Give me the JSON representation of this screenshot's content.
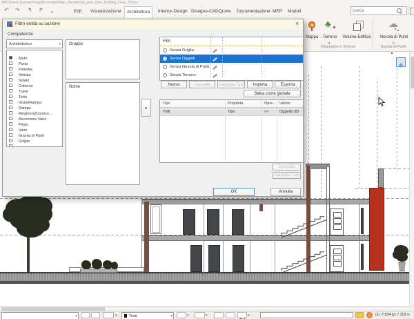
{
  "window": {
    "title": "ARCI5.test, Esempi-Progetti-completi\\Bari_Residential_park_First_Building_Final_TP.pso"
  },
  "ribbon": {
    "tabs": [
      "Edit",
      "Visualizzazione",
      "Architettura",
      "Interior-Design",
      "Disegno-CAD",
      "Quote",
      "Documentazione",
      "MEP",
      "Moduli"
    ],
    "active_tab": "Architettura",
    "search_placeholder": "Cerca",
    "groups": [
      {
        "label": "Volumetrie e Terreno",
        "buttons": [
          {
            "label": "Mappa"
          },
          {
            "label": "Terreno"
          },
          {
            "label": "Volume-Edificio"
          }
        ]
      },
      {
        "label": "Nuvola di Punti",
        "buttons": [
          {
            "label": "Nuvola di Punti"
          }
        ]
      }
    ]
  },
  "dialog": {
    "title": "Filtro entità su sezione",
    "section_label": "Competenze",
    "discipline": "Architettonico",
    "entities": [
      "Muro",
      "Porta",
      "Finestra",
      "Vetrata",
      "Solaio",
      "Colonna",
      "Trave",
      "Tetto",
      "Scala/Rampa",
      "Rampa",
      "Ringhiera/Cornice...",
      "Ascensore-Vano",
      "Plinto",
      "Vano",
      "Nuvola di Punti",
      "Griglia"
    ],
    "gruppo_label": "Gruppo",
    "nome_label": "Nome",
    "filters": {
      "header": "Filtri",
      "items": [
        {
          "label": "Senza Griglia",
          "selected": false
        },
        {
          "label": "Senza Oggetti",
          "selected": true
        },
        {
          "label": "Senza Nuvola di Punti",
          "selected": false
        },
        {
          "label": "Senza Terreno",
          "selected": false
        }
      ]
    },
    "buttons": {
      "nuovo": "Nuovo",
      "cancella": "Cancella",
      "cancella_tutti": "Cancella Tutti",
      "importa": "Importa",
      "esporta": "Esporta",
      "salva_globale": "Salva come globale",
      "ok": "OK",
      "annulla": "Annulla"
    },
    "criteria": {
      "columns": [
        "Tipo",
        "Proprietà",
        "Oper...",
        "Valore"
      ],
      "row": [
        "Tutti",
        "Tipo",
        "<>",
        "Oggetto 3D"
      ]
    }
  },
  "statusbar": {
    "text_style": "Testi",
    "coords": "(x) -7.834   (y) 7.319 m"
  },
  "colors": {
    "selection_blue": "#1b74d1",
    "accent_red": "#b5321f",
    "ribbon_bg": "#f5f2ef",
    "dialog_bg": "#f0f0f0",
    "dialog_titlebar": "#fbf7e3"
  }
}
